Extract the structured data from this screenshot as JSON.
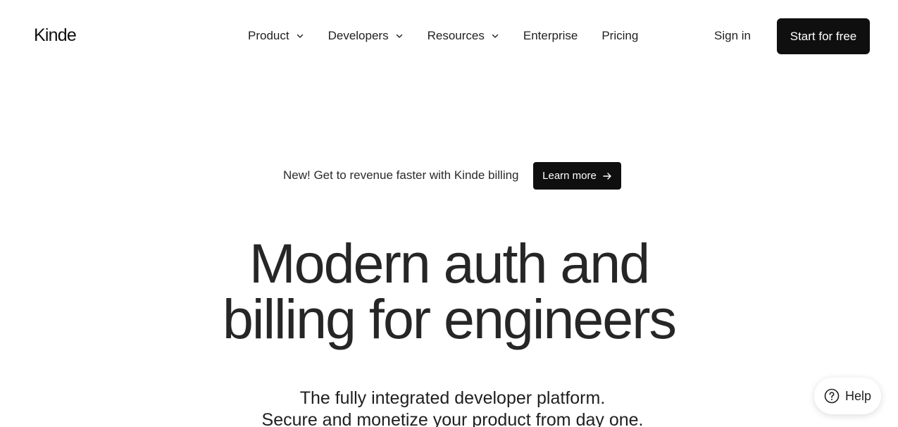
{
  "header": {
    "logo": "Kinde",
    "nav": {
      "product": "Product",
      "developers": "Developers",
      "resources": "Resources",
      "enterprise": "Enterprise",
      "pricing": "Pricing"
    },
    "sign_in": "Sign in",
    "cta": "Start for free"
  },
  "announcement": {
    "text": "New! Get to revenue faster with Kinde billing",
    "button": "Learn more"
  },
  "hero": {
    "title_line1": "Modern auth and",
    "title_line2": "billing for engineers",
    "subtitle_line1": "The fully integrated developer platform.",
    "subtitle_line2": "Secure and monetize your product from day one."
  },
  "help": {
    "label": "Help"
  },
  "colors": {
    "primary_button": "#0f0f0f",
    "text": "#1f1f1f",
    "background": "#ffffff"
  },
  "icons": {
    "chevron": "chevron-down-icon",
    "arrow": "arrow-right-icon",
    "help": "question-circle-icon"
  }
}
